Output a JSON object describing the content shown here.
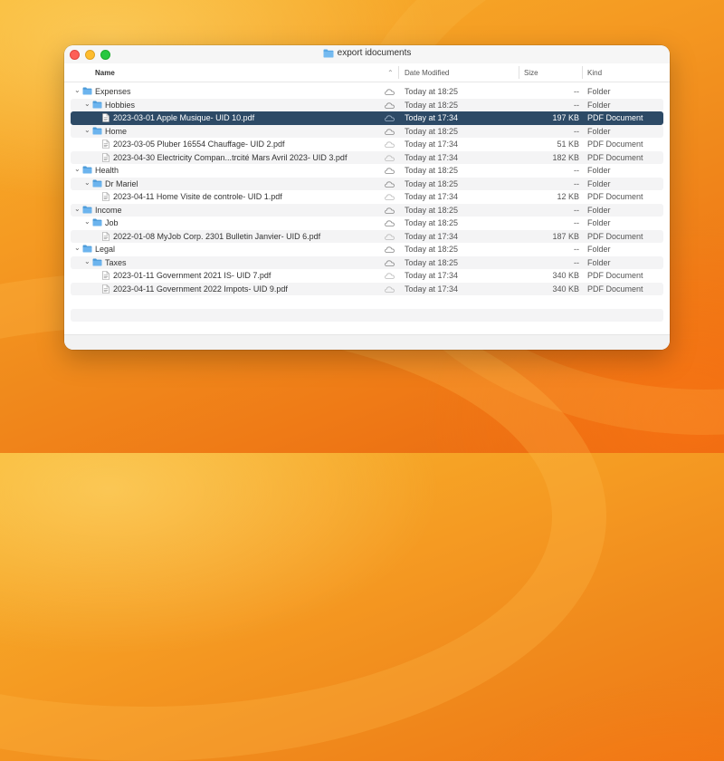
{
  "window": {
    "title": "export idocuments"
  },
  "columns": {
    "name": "Name",
    "date": "Date Modified",
    "size": "Size",
    "kind": "Kind"
  },
  "rows": [
    {
      "name": "Expenses",
      "level": 0,
      "type": "folder",
      "date": "Today at 18:25",
      "size": "--",
      "kind": "Folder"
    },
    {
      "name": "Hobbies",
      "level": 1,
      "type": "folder",
      "date": "Today at 18:25",
      "size": "--",
      "kind": "Folder"
    },
    {
      "name": "2023-03-01 Apple  Musique- UID 10.pdf",
      "level": 2,
      "type": "file",
      "date": "Today at 17:34",
      "size": "197 KB",
      "kind": "PDF Document",
      "selected": true
    },
    {
      "name": "Home",
      "level": 1,
      "type": "folder",
      "date": "Today at 18:25",
      "size": "--",
      "kind": "Folder"
    },
    {
      "name": "2023-03-05 Pluber 16554 Chauffage- UID 2.pdf",
      "level": 2,
      "type": "file",
      "date": "Today at 17:34",
      "size": "51 KB",
      "kind": "PDF Document"
    },
    {
      "name": "2023-04-30 Electricity Compan...trcité Mars Avril 2023- UID 3.pdf",
      "level": 2,
      "type": "file",
      "date": "Today at 17:34",
      "size": "182 KB",
      "kind": "PDF Document"
    },
    {
      "name": "Health",
      "level": 0,
      "type": "folder",
      "date": "Today at 18:25",
      "size": "--",
      "kind": "Folder"
    },
    {
      "name": "Dr Mariel",
      "level": 1,
      "type": "folder",
      "date": "Today at 18:25",
      "size": "--",
      "kind": "Folder"
    },
    {
      "name": "2023-04-11 Home  Visite de controle- UID 1.pdf",
      "level": 2,
      "type": "file",
      "date": "Today at 17:34",
      "size": "12 KB",
      "kind": "PDF Document"
    },
    {
      "name": "Income",
      "level": 0,
      "type": "folder",
      "date": "Today at 18:25",
      "size": "--",
      "kind": "Folder"
    },
    {
      "name": "Job",
      "level": 1,
      "type": "folder",
      "date": "Today at 18:25",
      "size": "--",
      "kind": "Folder"
    },
    {
      "name": "2022-01-08 MyJob Corp. 2301 Bulletin Janvier- UID 6.pdf",
      "level": 2,
      "type": "file",
      "date": "Today at 17:34",
      "size": "187 KB",
      "kind": "PDF Document"
    },
    {
      "name": "Legal",
      "level": 0,
      "type": "folder",
      "date": "Today at 18:25",
      "size": "--",
      "kind": "Folder"
    },
    {
      "name": "Taxes",
      "level": 1,
      "type": "folder",
      "date": "Today at 18:25",
      "size": "--",
      "kind": "Folder"
    },
    {
      "name": "2023-01-11 Government 2021 IS- UID 7.pdf",
      "level": 2,
      "type": "file",
      "date": "Today at 17:34",
      "size": "340 KB",
      "kind": "PDF Document"
    },
    {
      "name": "2023-04-11 Government 2022 Impots- UID 9.pdf",
      "level": 2,
      "type": "file",
      "date": "Today at 17:34",
      "size": "340 KB",
      "kind": "PDF Document"
    }
  ],
  "colors": {
    "selection": "#2d4a66",
    "folder": "#5aa9e6",
    "close": "#fe5f57",
    "minimize": "#febc2e",
    "maximize": "#28c840"
  }
}
